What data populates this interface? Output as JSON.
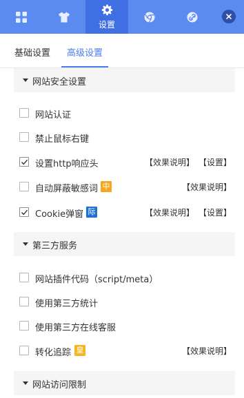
{
  "topbar": {
    "items": [
      {
        "icon": "grid-icon"
      },
      {
        "icon": "shirt-icon"
      },
      {
        "icon": "gear-icon",
        "label": "设置",
        "active": true
      },
      {
        "icon": "chrome-icon"
      },
      {
        "icon": "link-icon"
      }
    ],
    "close_icon": "close-icon"
  },
  "tabs": [
    {
      "label": "基础设置"
    },
    {
      "label": "高级设置",
      "active": true
    }
  ],
  "sections": [
    {
      "title": "网站安全设置",
      "items": [
        {
          "label": "网站认证",
          "checked": false
        },
        {
          "label": "禁止鼠标右键",
          "checked": false
        },
        {
          "label": "设置http响应头",
          "checked": true,
          "links": [
            "【效果说明】",
            "【设置】"
          ]
        },
        {
          "label": "自动屏蔽敏感词",
          "checked": false,
          "badge": "中",
          "links": [
            "【效果说明】"
          ]
        },
        {
          "label": "Cookie弹窗",
          "checked": true,
          "badge": "际",
          "links": [
            "【效果说明】",
            "【设置】"
          ]
        }
      ]
    },
    {
      "title": "第三方服务",
      "items": [
        {
          "label": "网站插件代码（script/meta）",
          "checked": false
        },
        {
          "label": "使用第三方统计",
          "checked": false
        },
        {
          "label": "使用第三方在线客服",
          "checked": false
        },
        {
          "label": "转化追踪",
          "checked": false,
          "badge": "皇",
          "links": [
            "【效果说明】"
          ]
        }
      ]
    },
    {
      "title": "网站访问限制",
      "items": []
    }
  ],
  "colors": {
    "topbar": "#5b8af0",
    "topbar_active": "#3f6fe3",
    "accent": "#4a7cf0",
    "badge_orange": "#f5a623",
    "badge_blue": "#1f6fd6",
    "badge_gold": "#f2b722"
  }
}
